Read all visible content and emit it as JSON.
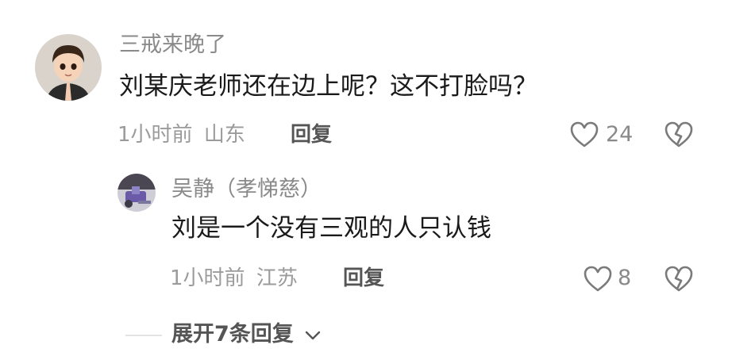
{
  "comments": [
    {
      "username": "三戒来晚了",
      "text": "刘某庆老师还在边上呢？这不打脸吗？",
      "time": "1小时前",
      "location": "山东",
      "reply_label": "回复",
      "likes": "24"
    }
  ],
  "replies": [
    {
      "username": "吴静（孝悌慈）",
      "text": "刘是一个没有三观的人只认钱",
      "time": "1小时前",
      "location": "江苏",
      "reply_label": "回复",
      "likes": "8"
    }
  ],
  "expand_label": "展开7条回复",
  "icons": {
    "like": "heart-outline-icon",
    "dislike": "broken-heart-icon",
    "expand": "chevron-down-icon"
  },
  "colors": {
    "username": "#8a8a8a",
    "text": "#1a1a1a",
    "meta": "#9b9b9b"
  }
}
